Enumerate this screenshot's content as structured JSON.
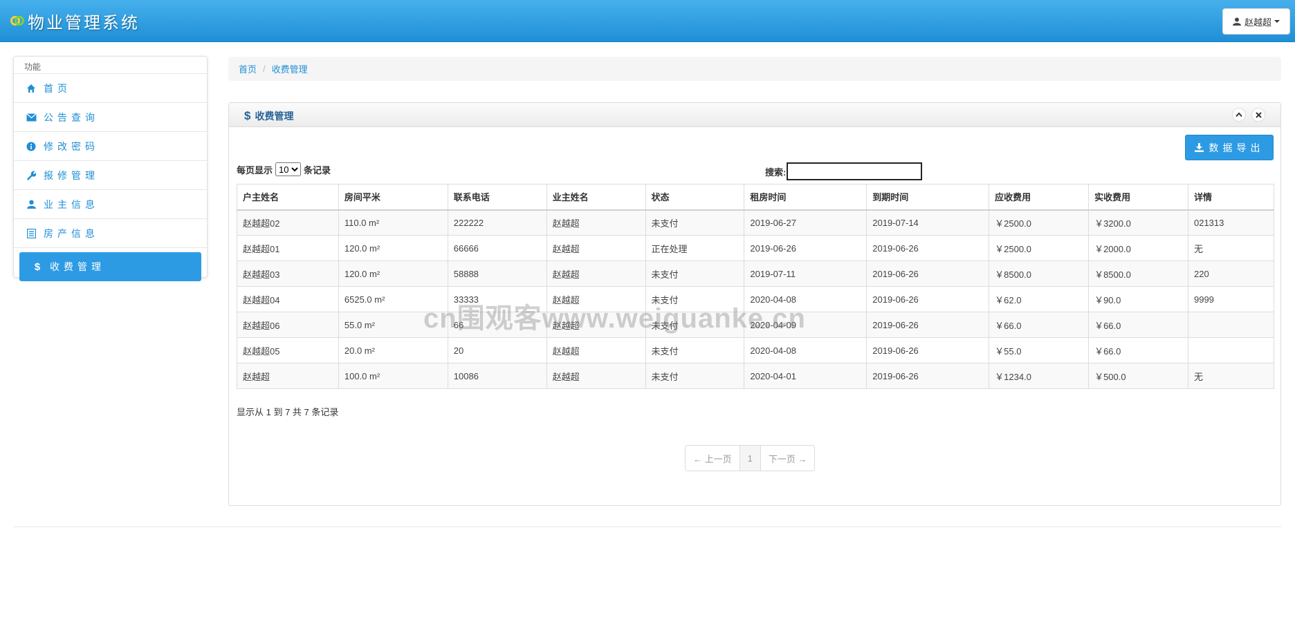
{
  "header": {
    "title": "物业管理系统",
    "user_name": "赵越超"
  },
  "sidebar": {
    "section_label": "功能",
    "items": [
      {
        "label": "首页",
        "icon": "home-icon"
      },
      {
        "label": "公告查询",
        "icon": "envelope-icon"
      },
      {
        "label": "修改密码",
        "icon": "info-icon"
      },
      {
        "label": "报修管理",
        "icon": "wrench-icon"
      },
      {
        "label": "业主信息",
        "icon": "user-icon"
      },
      {
        "label": "房产信息",
        "icon": "list-icon"
      },
      {
        "label": "收费管理",
        "icon": "dollar-icon",
        "active": true
      }
    ]
  },
  "breadcrumb": {
    "home": "首页",
    "current": "收费管理"
  },
  "panel": {
    "title": "收费管理",
    "export_label": "数据导出",
    "length_prefix": "每页显示",
    "length_value": "10",
    "length_suffix": "条记录",
    "search_label": "搜索:",
    "search_value": ""
  },
  "table": {
    "columns": [
      "户主姓名",
      "房间平米",
      "联系电话",
      "业主姓名",
      "状态",
      "租房时间",
      "到期时间",
      "应收费用",
      "实收费用",
      "详情"
    ],
    "rows": [
      [
        "赵越超02",
        "110.0 m²",
        "222222",
        "赵越超",
        "未支付",
        "2019-06-27",
        "2019-07-14",
        "￥2500.0",
        "￥3200.0",
        "021313"
      ],
      [
        "赵越超01",
        "120.0 m²",
        "66666",
        "赵越超",
        "正在处理",
        "2019-06-26",
        "2019-06-26",
        "￥2500.0",
        "￥2000.0",
        "无"
      ],
      [
        "赵越超03",
        "120.0 m²",
        "58888",
        "赵越超",
        "未支付",
        "2019-07-11",
        "2019-06-26",
        "￥8500.0",
        "￥8500.0",
        "220"
      ],
      [
        "赵越超04",
        "6525.0 m²",
        "33333",
        "赵越超",
        "未支付",
        "2020-04-08",
        "2019-06-26",
        "￥62.0",
        "￥90.0",
        "9999"
      ],
      [
        "赵越超06",
        "55.0 m²",
        "66",
        "赵越超",
        "未支付",
        "2020-04-09",
        "2019-06-26",
        "￥66.0",
        "￥66.0",
        ""
      ],
      [
        "赵越超05",
        "20.0 m²",
        "20",
        "赵越超",
        "未支付",
        "2020-04-08",
        "2019-06-26",
        "￥55.0",
        "￥66.0",
        ""
      ],
      [
        "赵越超",
        "100.0 m²",
        "10086",
        "赵越超",
        "未支付",
        "2020-04-01",
        "2019-06-26",
        "￥1234.0",
        "￥500.0",
        "无"
      ]
    ]
  },
  "info_text": "显示从 1 到 7 共 7 条记录",
  "pager": {
    "prev": "← 上一页",
    "page": "1",
    "next": "下一页 →"
  },
  "watermark": "cn围观客www.weiguanke.cn",
  "colors": {
    "header_blue": "#1f8fd6",
    "accent_blue": "#2d9be3",
    "title_blue": "#2a6496"
  }
}
